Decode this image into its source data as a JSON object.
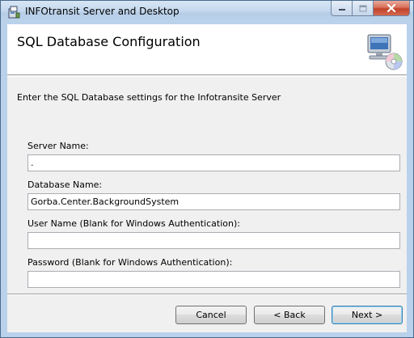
{
  "window": {
    "title": "INFOtransit Server and Desktop",
    "app_icon": "installer-icon",
    "caption_buttons": [
      "minimize-icon",
      "maximize-icon",
      "close-icon"
    ]
  },
  "banner": {
    "title": "SQL Database Configuration",
    "icon": "computer-cd-icon"
  },
  "description": "Enter the SQL Database settings for the Infotransite Server",
  "fields": {
    "server_name": {
      "label": "Server Name:",
      "value": "."
    },
    "database_name": {
      "label": "Database Name:",
      "value": "Gorba.Center.BackgroundSystem"
    },
    "user_name": {
      "label": "User Name (Blank for Windows Authentication):",
      "value": ""
    },
    "password": {
      "label": "Password (Blank for Windows Authentication):",
      "value": ""
    }
  },
  "buttons": {
    "cancel": "Cancel",
    "back": "< Back",
    "next": "Next >"
  },
  "colors": {
    "frame": "#b9d1ea",
    "client": "#f0f0f0",
    "close_button": "#c2432a",
    "default_button_border": "#3c7fb1"
  }
}
